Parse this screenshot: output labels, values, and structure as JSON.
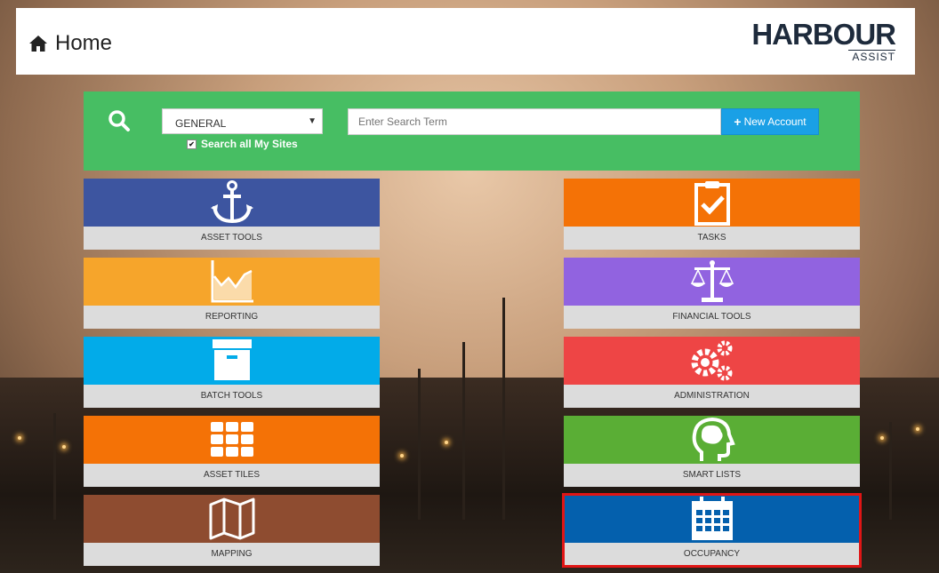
{
  "header": {
    "title": "Home",
    "logo_main": "HARBOUR",
    "logo_sub": "ASSIST"
  },
  "search": {
    "select_value": "GENERAL",
    "checkbox_label": "Search all My Sites",
    "placeholder": "Enter Search Term",
    "new_account_label": "New Account"
  },
  "tiles": [
    {
      "label": "ASSET TOOLS",
      "color": "#3d55a0",
      "icon": "anchor-icon"
    },
    {
      "label": "TASKS",
      "color": "#f47206",
      "icon": "clipboard-check-icon"
    },
    {
      "label": "REPORTING",
      "color": "#f6a52b",
      "icon": "area-chart-icon"
    },
    {
      "label": "FINANCIAL TOOLS",
      "color": "#9163e0",
      "icon": "scales-icon"
    },
    {
      "label": "BATCH TOOLS",
      "color": "#02abe9",
      "icon": "archive-box-icon"
    },
    {
      "label": "ADMINISTRATION",
      "color": "#ee4545",
      "icon": "gears-icon"
    },
    {
      "label": "ASSET TILES",
      "color": "#f47206",
      "icon": "grid-tiles-icon"
    },
    {
      "label": "SMART LISTS",
      "color": "#5aae35",
      "icon": "brain-head-icon"
    },
    {
      "label": "MAPPING",
      "color": "#8e4c30",
      "icon": "map-icon"
    },
    {
      "label": "OCCUPANCY",
      "color": "#0460ad",
      "icon": "calendar-icon"
    }
  ]
}
